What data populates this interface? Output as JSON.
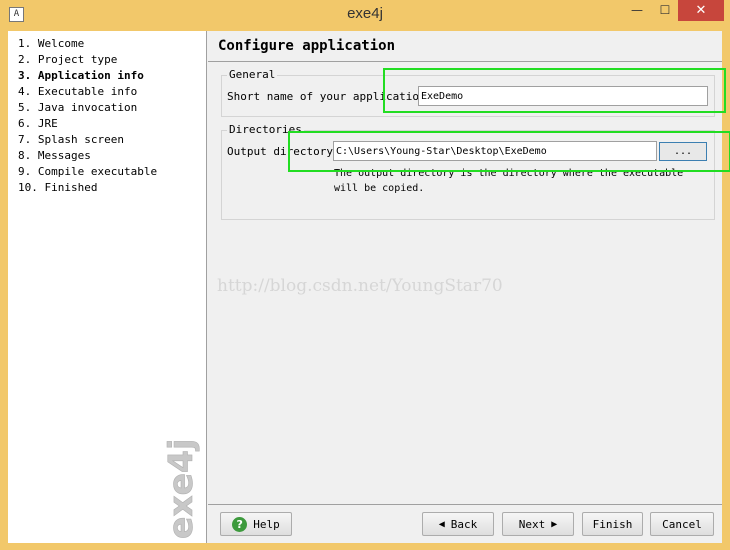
{
  "window": {
    "title": "exe4j",
    "minimize": "—",
    "maximize": "☐",
    "close": "✕"
  },
  "sidebar": {
    "steps": [
      {
        "label": "1. Welcome"
      },
      {
        "label": "2. Project type"
      },
      {
        "label": "3. Application info"
      },
      {
        "label": "4. Executable info"
      },
      {
        "label": "5. Java invocation"
      },
      {
        "label": "6. JRE"
      },
      {
        "label": "7. Splash screen"
      },
      {
        "label": "8. Messages"
      },
      {
        "label": "9. Compile executable"
      },
      {
        "label": "10. Finished"
      }
    ],
    "active_step": 3,
    "logo": "exe4j"
  },
  "main": {
    "title": "Configure application",
    "general": {
      "legend": "General",
      "short_name_label": "Short name of your application:",
      "short_name_value": "ExeDemo"
    },
    "directories": {
      "legend": "Directories",
      "output_label": "Output directory:",
      "output_value": "C:\\Users\\Young-Star\\Desktop\\ExeDemo",
      "browse_label": "...",
      "hint": "The output directory is the directory where the executable will be copied."
    },
    "watermark": "http://blog.csdn.net/YoungStar70"
  },
  "footer": {
    "help": "Help",
    "back": "Back",
    "next": "Next",
    "finish": "Finish",
    "cancel": "Cancel"
  },
  "colors": {
    "titlebar": "#f2c86a",
    "close": "#c7463c",
    "highlight": "#22dd22",
    "help_icon": "#3d9a3d"
  }
}
